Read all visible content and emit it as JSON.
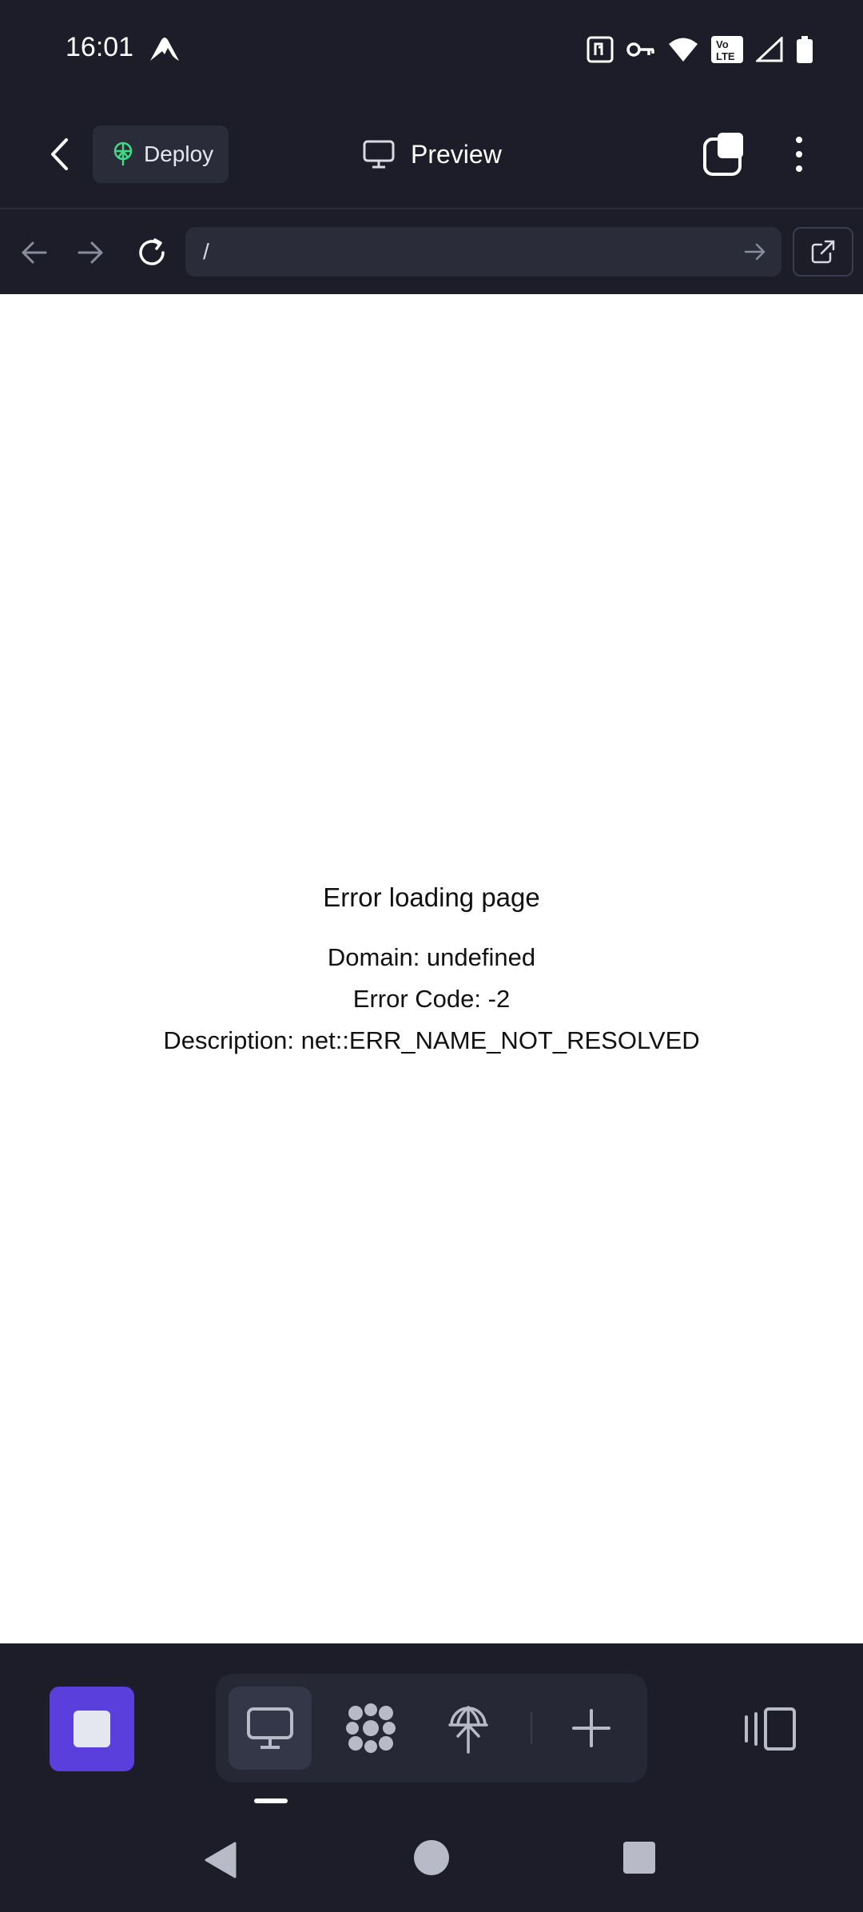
{
  "status_bar": {
    "time": "16:01",
    "icons": [
      "nordvpn-icon",
      "nfc-icon",
      "vpn-key-icon",
      "wifi-icon",
      "volte-icon",
      "signal-icon",
      "battery-icon"
    ],
    "volte_label_top": "Vo",
    "volte_label_bottom": "LTE"
  },
  "header": {
    "back_icon": "chevron-left-icon",
    "deploy_label": "Deploy",
    "deploy_icon": "deploy-globe-icon",
    "deploy_icon_color": "#3ddc84",
    "preview_icon": "monitor-icon",
    "preview_label": "Preview",
    "tabs_icon": "tabs-icon",
    "menu_icon": "more-vertical-icon"
  },
  "url_bar": {
    "back_icon": "arrow-left-icon",
    "forward_icon": "arrow-right-icon",
    "reload_icon": "reload-icon",
    "url_value": "/",
    "go_icon": "arrow-right-icon",
    "external_icon": "external-link-icon"
  },
  "content": {
    "error_title": "Error loading page",
    "domain_line": "Domain: undefined",
    "code_line": "Error Code: -2",
    "description_line": "Description: net::ERR_NAME_NOT_RESOLVED"
  },
  "bottom_toolbar": {
    "stop_icon": "stop-icon",
    "accent_color": "#5b3fdc",
    "tools": [
      {
        "name": "preview",
        "icon": "monitor-icon",
        "active": true
      },
      {
        "name": "workspace",
        "icon": "replit-icon",
        "active": false
      },
      {
        "name": "deploy",
        "icon": "deploy-globe-icon",
        "active": false
      },
      {
        "name": "add",
        "icon": "plus-icon",
        "active": false
      }
    ],
    "side_icon": "panel-toggle-icon"
  },
  "android_nav": {
    "back_icon": "triangle-back-icon",
    "home_icon": "circle-home-icon",
    "recent_icon": "square-recent-icon"
  }
}
